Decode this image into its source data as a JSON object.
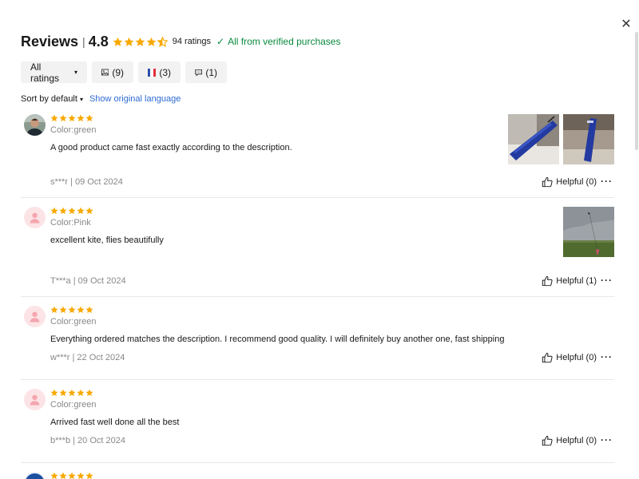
{
  "header": {
    "title": "Reviews",
    "separator": "|",
    "average": "4.8",
    "rating_count": "94 ratings",
    "verified_text": "All from verified purchases",
    "star_color": "#f8a900"
  },
  "filters": {
    "all_ratings": "All ratings",
    "photos_count": "(9)",
    "country_count": "(3)",
    "comments_count": "(1)"
  },
  "sort": {
    "label": "Sort by default",
    "original_language": "Show original language"
  },
  "reviews": [
    {
      "stars": 5,
      "color": "Color:green",
      "text": "A good product came fast exactly according to the description.",
      "meta": "s***r | 09 Oct 2024",
      "helpful": "Helpful (0)",
      "photos": [
        "kite-bag-photo",
        "kite-bag-photo"
      ]
    },
    {
      "stars": 5,
      "color": "Color:Pink",
      "text": "excellent kite, flies beautifully",
      "meta": "T***a | 09 Oct 2024",
      "helpful": "Helpful (1)",
      "photos": [
        "field-kite-photo"
      ]
    },
    {
      "stars": 5,
      "color": "Color:green",
      "text": "Everything ordered matches the description. I recommend good quality. I will definitely buy another one, fast shipping",
      "meta": "w***r | 22 Oct 2024",
      "helpful": "Helpful (0)",
      "photos": []
    },
    {
      "stars": 5,
      "color": "Color:green",
      "text": "Arrived fast well done all the best",
      "meta": "b***b | 20 Oct 2024",
      "helpful": "Helpful (0)",
      "photos": []
    },
    {
      "stars": 5,
      "color": "",
      "text": "",
      "meta": "",
      "helpful": "",
      "photos": []
    }
  ],
  "more_label": "···"
}
